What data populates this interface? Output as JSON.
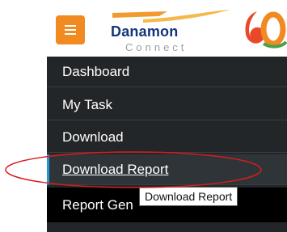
{
  "header": {
    "brand_name": "Danamon",
    "brand_sub": "Connect",
    "anniversary_mark": "60",
    "menu_icon": "hamburger-icon"
  },
  "sidebar": {
    "items": [
      {
        "label": "Dashboard"
      },
      {
        "label": "My Task"
      },
      {
        "label": "Download"
      },
      {
        "label": "Download Report"
      },
      {
        "label": "Report Gen"
      }
    ]
  },
  "tooltip": {
    "text": "Download Report"
  },
  "colors": {
    "accent_orange": "#f18a21",
    "sidebar_bg": "#232628",
    "active_indicator": "#1f9ad6",
    "annotation_red": "#d91c1c"
  }
}
